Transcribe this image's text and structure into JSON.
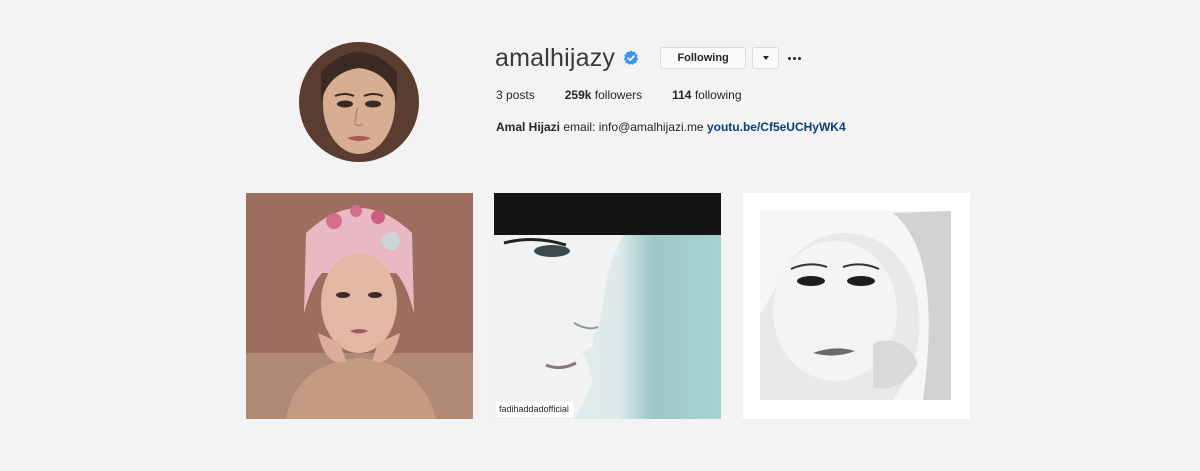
{
  "profile": {
    "username": "amalhijazy",
    "verified": true,
    "verified_color": "#3897f0",
    "avatar_alt": "",
    "following_label": "Following",
    "dropdown_icon": "caret-down-icon",
    "more_icon": "more-dots-icon"
  },
  "stats": {
    "posts_count": "3",
    "posts_label": "posts",
    "followers_count": "259k",
    "followers_label": "followers",
    "following_count": "114",
    "following_label": "following"
  },
  "bio": {
    "full_name": "Amal Hijazi",
    "text": "email: info@amalhijazi.me",
    "link_text": "youtu.be/Cf5eUCHyWK4",
    "link_color": "#0b3f7a"
  },
  "posts": [
    {
      "tag": ""
    },
    {
      "tag": "fadihaddadofficial"
    },
    {
      "tag": ""
    }
  ]
}
